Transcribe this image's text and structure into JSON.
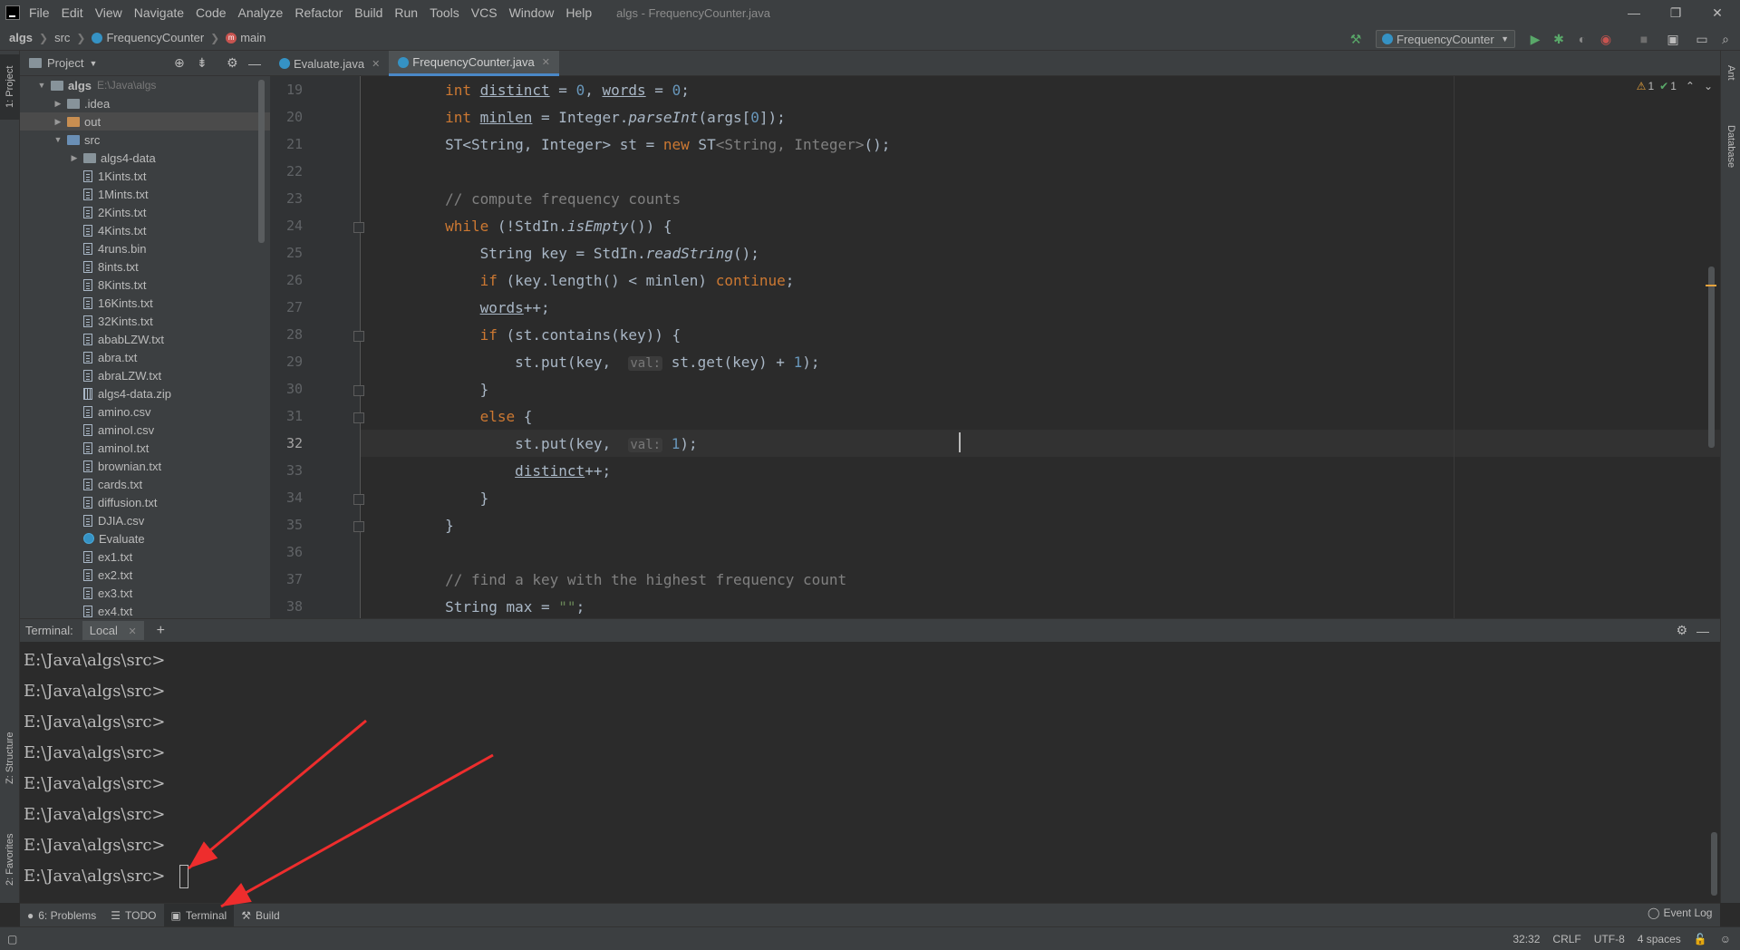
{
  "window": {
    "title": "algs - FrequencyCounter.java",
    "menus": [
      "File",
      "Edit",
      "View",
      "Navigate",
      "Code",
      "Analyze",
      "Refactor",
      "Build",
      "Run",
      "Tools",
      "VCS",
      "Window",
      "Help"
    ],
    "controls": {
      "minimize": "—",
      "restore": "❐",
      "close": "✕"
    }
  },
  "breadcrumb": {
    "project": "algs",
    "folder": "src",
    "class": "FrequencyCounter",
    "method": "main"
  },
  "toolbar": {
    "run_config": "FrequencyCounter",
    "accent_run": "#59a869",
    "accent_debug": "#59a869"
  },
  "stripes": {
    "left_top": "1: Project",
    "left_structure": "Z: Structure",
    "left_favorites": "2: Favorites",
    "right_ant": "Ant",
    "right_database": "Database"
  },
  "project": {
    "header": "Project",
    "root_name": "algs",
    "root_path": "E:\\Java\\algs",
    "items": [
      {
        "label": ".idea",
        "type": "folder",
        "depth": 1,
        "expandable": true
      },
      {
        "label": "out",
        "type": "folder-out",
        "depth": 1,
        "expandable": true,
        "selected": true
      },
      {
        "label": "src",
        "type": "folder-src",
        "depth": 1,
        "expanded": true
      },
      {
        "label": "algs4-data",
        "type": "folder",
        "depth": 2,
        "expandable": true
      },
      {
        "label": "1Kints.txt",
        "type": "file",
        "depth": 2
      },
      {
        "label": "1Mints.txt",
        "type": "file",
        "depth": 2
      },
      {
        "label": "2Kints.txt",
        "type": "file",
        "depth": 2
      },
      {
        "label": "4Kints.txt",
        "type": "file",
        "depth": 2
      },
      {
        "label": "4runs.bin",
        "type": "file",
        "depth": 2
      },
      {
        "label": "8ints.txt",
        "type": "file",
        "depth": 2
      },
      {
        "label": "8Kints.txt",
        "type": "file",
        "depth": 2
      },
      {
        "label": "16Kints.txt",
        "type": "file",
        "depth": 2
      },
      {
        "label": "32Kints.txt",
        "type": "file",
        "depth": 2
      },
      {
        "label": "ababLZW.txt",
        "type": "file",
        "depth": 2
      },
      {
        "label": "abra.txt",
        "type": "file",
        "depth": 2
      },
      {
        "label": "abraLZW.txt",
        "type": "file",
        "depth": 2
      },
      {
        "label": "algs4-data.zip",
        "type": "zip",
        "depth": 2
      },
      {
        "label": "amino.csv",
        "type": "file",
        "depth": 2
      },
      {
        "label": "aminoI.csv",
        "type": "file",
        "depth": 2
      },
      {
        "label": "aminoI.txt",
        "type": "file",
        "depth": 2
      },
      {
        "label": "brownian.txt",
        "type": "file",
        "depth": 2
      },
      {
        "label": "cards.txt",
        "type": "file",
        "depth": 2
      },
      {
        "label": "diffusion.txt",
        "type": "file",
        "depth": 2
      },
      {
        "label": "DJIA.csv",
        "type": "file",
        "depth": 2
      },
      {
        "label": "Evaluate",
        "type": "class",
        "depth": 2
      },
      {
        "label": "ex1.txt",
        "type": "file",
        "depth": 2
      },
      {
        "label": "ex2.txt",
        "type": "file",
        "depth": 2
      },
      {
        "label": "ex3.txt",
        "type": "file",
        "depth": 2
      },
      {
        "label": "ex4.txt",
        "type": "file",
        "depth": 2
      }
    ]
  },
  "tabs": [
    {
      "label": "Evaluate.java",
      "active": false
    },
    {
      "label": "FrequencyCounter.java",
      "active": true
    }
  ],
  "editor": {
    "inspections": {
      "warnings": "1",
      "weak": "1"
    },
    "current_line": 32,
    "lines": [
      {
        "n": "19",
        "html": "        <span class='kw'>int</span> <span class='ul'>distinct</span> = <span class='num'>0</span>, <span class='ul'>words</span> = <span class='num'>0</span>;"
      },
      {
        "n": "20",
        "html": "        <span class='kw'>int</span> <span class='ul'>minlen</span> = Integer.<span class='fn-it'>parseInt</span>(args[<span class='num'>0</span>]);"
      },
      {
        "n": "21",
        "html": "        ST&lt;String, Integer&gt; st = <span class='kw'>new</span> ST<span class='gen'>&lt;String, Integer&gt;</span>();"
      },
      {
        "n": "22",
        "html": ""
      },
      {
        "n": "23",
        "html": "        <span class='cmt'>// compute frequency counts</span>"
      },
      {
        "n": "24",
        "html": "        <span class='kw'>while</span> (!StdIn.<span class='fn-it'>isEmpty</span>()) {"
      },
      {
        "n": "25",
        "html": "            String key = StdIn.<span class='fn-it'>readString</span>();"
      },
      {
        "n": "26",
        "html": "            <span class='kw'>if</span> (key.length() &lt; minlen) <span class='kw'>continue</span>;"
      },
      {
        "n": "27",
        "html": "            <span class='ul'>words</span>++;"
      },
      {
        "n": "28",
        "html": "            <span class='kw'>if</span> (st.contains(key)) {"
      },
      {
        "n": "29",
        "html": "                st.put(key,  <span class='hint'>val:</span> st.get(key) + <span class='num'>1</span>);"
      },
      {
        "n": "30",
        "html": "            }"
      },
      {
        "n": "31",
        "html": "            <span class='kw'>else</span> {"
      },
      {
        "n": "32",
        "html": "                st.put(key,  <span class='hint'>val:</span> <span class='num'>1</span>);"
      },
      {
        "n": "33",
        "html": "                <span class='ul'>distinct</span>++;"
      },
      {
        "n": "34",
        "html": "            }"
      },
      {
        "n": "35",
        "html": "        }"
      },
      {
        "n": "36",
        "html": ""
      },
      {
        "n": "37",
        "html": "        <span class='cmt'>// find a key with the highest frequency count</span>"
      },
      {
        "n": "38",
        "html": "        String max = <span class='str'>\"\"</span>;"
      }
    ]
  },
  "terminal": {
    "label": "Terminal:",
    "session": "Local",
    "add": "+",
    "prompt": "E:\\Java\\algs\\src>",
    "prompt_count": 8
  },
  "tool_tabs": [
    {
      "label": "6: Problems",
      "icon": "problems-icon"
    },
    {
      "label": "TODO",
      "icon": "todo-icon"
    },
    {
      "label": "Terminal",
      "icon": "terminal-icon",
      "active": true
    },
    {
      "label": "Build",
      "icon": "build-icon"
    }
  ],
  "event_log": "Event Log",
  "status": {
    "position": "32:32",
    "line_sep": "CRLF",
    "encoding": "UTF-8",
    "indent": "4 spaces"
  },
  "annotation_color": "#ee2d2d"
}
